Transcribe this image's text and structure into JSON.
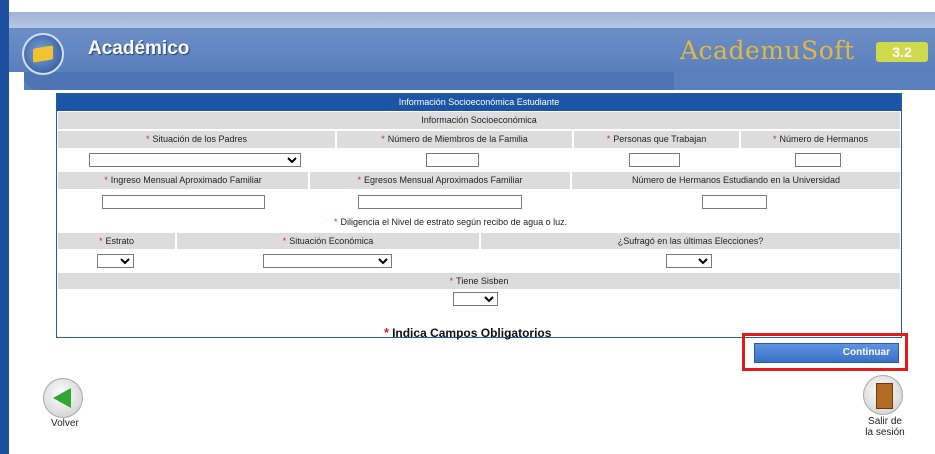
{
  "app": {
    "title": "Académico",
    "brand": "AcademuSoft",
    "version": "3.2"
  },
  "form": {
    "panel_title": "Información Socioeconómica Estudiante",
    "section_title": "Información Socioeconómica",
    "labels": {
      "situacion_padres": "Situación de los Padres",
      "numero_miembros": "Número de Miembros de la Familia",
      "personas_trabajan": "Personas que Trabajan",
      "numero_hermanos": "Número de Hermanos",
      "ingreso_mensual": "Ingreso Mensual Aproximado Familiar",
      "egresos_mensual": "Egresos Mensual Aproximados Familiar",
      "hermanos_universidad": "Número de Hermanos Estudiando en la Universidad",
      "estrato": "Estrato",
      "situacion_economica": "Situación Económica",
      "sufrago": "¿Sufragó en las últimas Elecciones?",
      "sisben": "Tiene Sisben"
    },
    "note": "Diligencia el Nivel de estrato según recibo de agua o luz.",
    "required_marker": "*",
    "required_note": "Indica Campos Obligatorios"
  },
  "buttons": {
    "continuar": "Continuar",
    "volver": "Volver",
    "salir_line1": "Salir de",
    "salir_line2": "la sesión"
  },
  "colors": {
    "header": "#5a7fbd",
    "panel_title": "#1c55a6",
    "required": "#d32828",
    "highlight": "#e21b1b",
    "brand": "#e3b93c"
  }
}
